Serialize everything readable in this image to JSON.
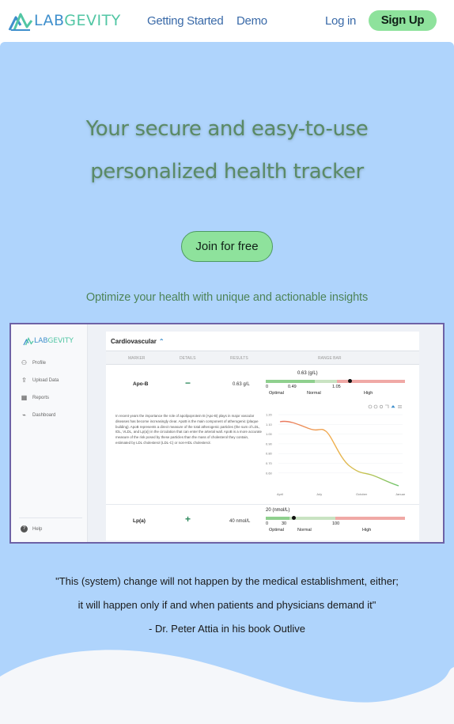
{
  "nav": {
    "brand_part1": "LAB",
    "brand_part2": "GEVITY",
    "getting_started": "Getting Started",
    "demo": "Demo",
    "login": "Log in",
    "signup": "Sign Up"
  },
  "hero": {
    "headline_line1": "Your secure and easy-to-use",
    "headline_line2": "personalized health tracker",
    "cta": "Join for free",
    "tagline": "Optimize your health with unique and actionable insights"
  },
  "preview": {
    "brand_part1": "LAB",
    "brand_part2": "GEVITY",
    "menu": [
      {
        "label": "Profile",
        "icon": "user-icon"
      },
      {
        "label": "Upload Data",
        "icon": "upload-icon"
      },
      {
        "label": "Reports",
        "icon": "table-icon"
      },
      {
        "label": "Dashboard",
        "icon": "chart-icon"
      }
    ],
    "help": "Help",
    "section_title": "Cardiovascular",
    "columns": [
      "MARKER",
      "DETAILS",
      "RESULTS",
      "RANGE BAR"
    ],
    "rows": [
      {
        "marker": "Apo-B",
        "toggle": "−",
        "result": "0.63 g/L",
        "range_title": "0.63 (g/L)",
        "ticks": [
          "0",
          "0.49",
          "1.05"
        ],
        "zones": [
          "Optimal",
          "Normal",
          "High"
        ],
        "marker_fraction": 0.6
      },
      {
        "marker": "Lp(a)",
        "toggle": "+",
        "result": "40 nmol/L",
        "range_title": "20 (nmol/L)",
        "ticks": [
          "0",
          "30",
          "100"
        ],
        "zones": [
          "Optimal",
          "Normal",
          "High"
        ],
        "marker_fraction": 0.2
      }
    ],
    "description": "In recent years the importance the role of apolipoprotein B (Apo-B) plays in major vascular diseases has become increasingly clear. ApoB is the main component of atherogenic (plaque building). ApoB represents a direct measure of the total atherogenic particles (the sum of LDL, IDL, VLDL, and Lp(a)) in the circulation that can enter the arterial wall. ApoB is a more accurate measure of the risk posed by these particles than the mass of cholesterol they contain, estimated by LDL cholesterol (LDL-C) or non-HDL cholesterol.",
    "chart_ticks_y": [
      "1.20",
      "1.10",
      "1.00",
      "0.90",
      "0.80",
      "0.70",
      "0.60"
    ],
    "chart_ticks_x": [
      "April",
      "July",
      "October",
      "January"
    ],
    "colors": {
      "optimal": "#8fd08e",
      "normal": "#c9e3c2",
      "high": "#f0a9a6",
      "accent": "#3f8fcc"
    }
  },
  "quote": {
    "line1": "\"This (system) change will not happen by the medical establishment, either;",
    "line2": "it will happen only if and when patients and physicians demand it\"",
    "attribution": "- Dr. Peter Attia in his book Outlive"
  },
  "colors": {
    "hero_bg": "#afd4fc",
    "cta_green": "#8ee29c",
    "headline": "#5a8a66",
    "nav_link": "#3a6aa8"
  }
}
